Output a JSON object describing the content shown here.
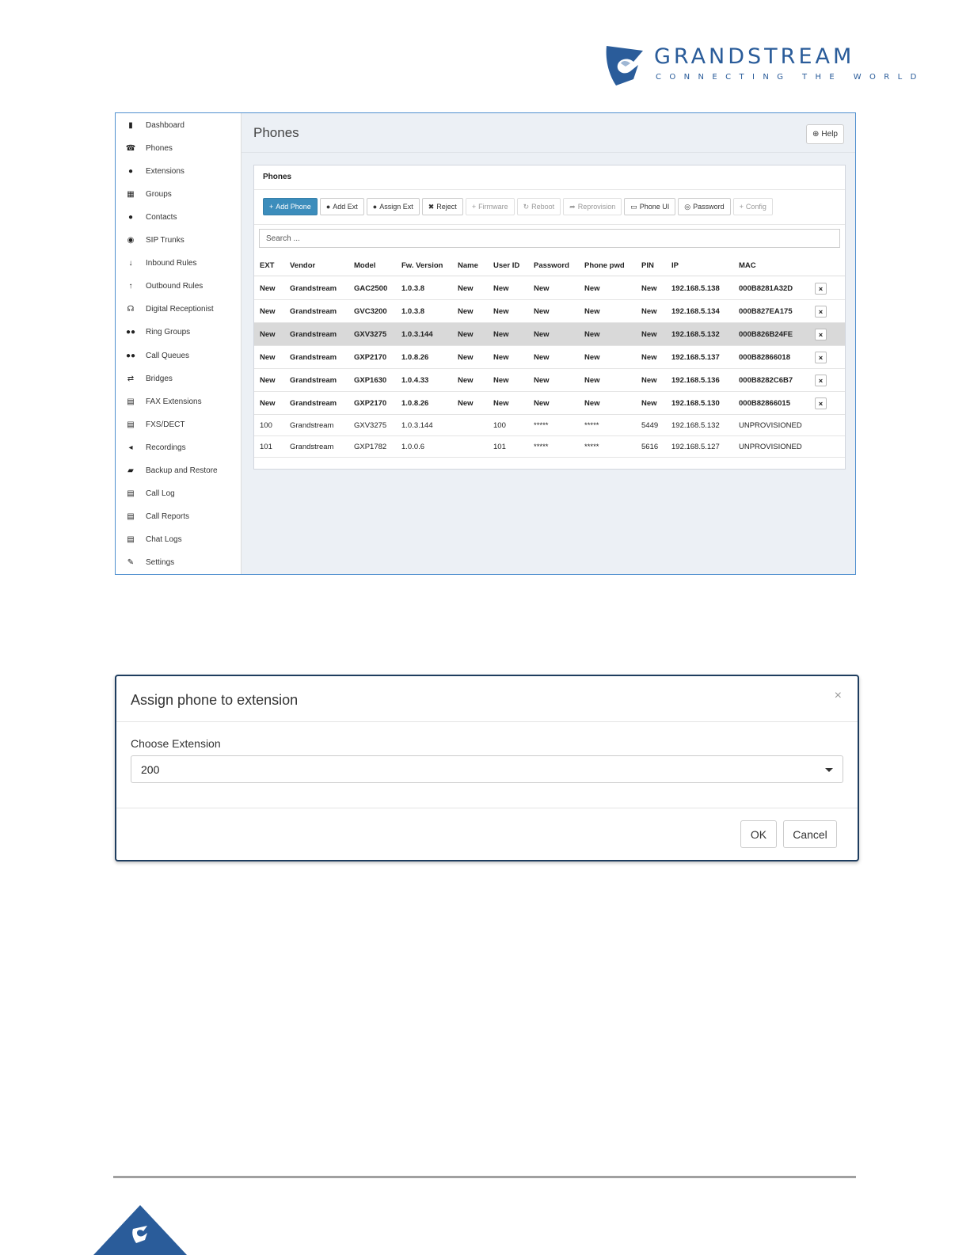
{
  "brand": {
    "name": "GRANDSTREAM",
    "tagline": "CONNECTING THE WORLD",
    "primary_color": "#2a5c9a"
  },
  "sidebar": {
    "items": [
      {
        "label": "Dashboard",
        "icon": "bar-chart-icon"
      },
      {
        "label": "Phones",
        "icon": "phone-icon"
      },
      {
        "label": "Extensions",
        "icon": "user-icon"
      },
      {
        "label": "Groups",
        "icon": "grid-icon"
      },
      {
        "label": "Contacts",
        "icon": "user-icon"
      },
      {
        "label": "SIP Trunks",
        "icon": "globe-icon"
      },
      {
        "label": "Inbound Rules",
        "icon": "arrow-down-icon"
      },
      {
        "label": "Outbound Rules",
        "icon": "arrow-up-icon"
      },
      {
        "label": "Digital Receptionist",
        "icon": "headset-icon"
      },
      {
        "label": "Ring Groups",
        "icon": "users-icon"
      },
      {
        "label": "Call Queues",
        "icon": "users-icon"
      },
      {
        "label": "Bridges",
        "icon": "exchange-icon"
      },
      {
        "label": "FAX Extensions",
        "icon": "fax-icon"
      },
      {
        "label": "FXS/DECT",
        "icon": "fax-icon"
      },
      {
        "label": "Recordings",
        "icon": "speaker-icon"
      },
      {
        "label": "Backup and Restore",
        "icon": "folder-open-icon"
      },
      {
        "label": "Call Log",
        "icon": "list-icon"
      },
      {
        "label": "Call Reports",
        "icon": "list-icon"
      },
      {
        "label": "Chat Logs",
        "icon": "list-icon"
      },
      {
        "label": "Settings",
        "icon": "wrench-icon"
      }
    ]
  },
  "page": {
    "title": "Phones",
    "help_label": "Help"
  },
  "panel": {
    "title": "Phones",
    "toolbar": [
      {
        "label": "Add Phone",
        "icon": "plus-icon",
        "state": "primary"
      },
      {
        "label": "Add Ext",
        "icon": "user-icon",
        "state": "normal"
      },
      {
        "label": "Assign Ext",
        "icon": "user-icon",
        "state": "normal"
      },
      {
        "label": "Reject",
        "icon": "times-icon",
        "state": "normal"
      },
      {
        "label": "Firmware",
        "icon": "plus-icon",
        "state": "disabled"
      },
      {
        "label": "Reboot",
        "icon": "refresh-icon",
        "state": "disabled"
      },
      {
        "label": "Reprovision",
        "icon": "share-icon",
        "state": "disabled"
      },
      {
        "label": "Phone UI",
        "icon": "window-icon",
        "state": "normal"
      },
      {
        "label": "Password",
        "icon": "eye-slash-icon",
        "state": "normal"
      },
      {
        "label": "Config",
        "icon": "plus-icon",
        "state": "disabled"
      }
    ],
    "search_placeholder": "Search ...",
    "columns": [
      "EXT",
      "Vendor",
      "Model",
      "Fw. Version",
      "Name",
      "User ID",
      "Password",
      "Phone pwd",
      "PIN",
      "IP",
      "MAC"
    ],
    "rows": [
      {
        "cells": [
          "New",
          "Grandstream",
          "GAC2500",
          "1.0.3.8",
          "New",
          "New",
          "New",
          "New",
          "New",
          "192.168.5.138",
          "000B8281A32D"
        ],
        "bold": true,
        "selected": false,
        "deletable": true
      },
      {
        "cells": [
          "New",
          "Grandstream",
          "GVC3200",
          "1.0.3.8",
          "New",
          "New",
          "New",
          "New",
          "New",
          "192.168.5.134",
          "000B827EA175"
        ],
        "bold": true,
        "selected": false,
        "deletable": true
      },
      {
        "cells": [
          "New",
          "Grandstream",
          "GXV3275",
          "1.0.3.144",
          "New",
          "New",
          "New",
          "New",
          "New",
          "192.168.5.132",
          "000B826B24FE"
        ],
        "bold": true,
        "selected": true,
        "deletable": true
      },
      {
        "cells": [
          "New",
          "Grandstream",
          "GXP2170",
          "1.0.8.26",
          "New",
          "New",
          "New",
          "New",
          "New",
          "192.168.5.137",
          "000B82866018"
        ],
        "bold": true,
        "selected": false,
        "deletable": true
      },
      {
        "cells": [
          "New",
          "Grandstream",
          "GXP1630",
          "1.0.4.33",
          "New",
          "New",
          "New",
          "New",
          "New",
          "192.168.5.136",
          "000B8282C6B7"
        ],
        "bold": true,
        "selected": false,
        "deletable": true
      },
      {
        "cells": [
          "New",
          "Grandstream",
          "GXP2170",
          "1.0.8.26",
          "New",
          "New",
          "New",
          "New",
          "New",
          "192.168.5.130",
          "000B82866015"
        ],
        "bold": true,
        "selected": false,
        "deletable": true
      },
      {
        "cells": [
          "100",
          "Grandstream",
          "GXV3275",
          "1.0.3.144",
          "",
          "100",
          "*****",
          "*****",
          "5449",
          "192.168.5.132",
          "UNPROVISIONED"
        ],
        "bold": false,
        "selected": false,
        "deletable": false
      },
      {
        "cells": [
          "101",
          "Grandstream",
          "GXP1782",
          "1.0.0.6",
          "",
          "101",
          "*****",
          "*****",
          "5616",
          "192.168.5.127",
          "UNPROVISIONED"
        ],
        "bold": false,
        "selected": false,
        "deletable": false
      }
    ],
    "delete_glyph": "×"
  },
  "dialog": {
    "title": "Assign phone to extension",
    "close_glyph": "×",
    "field_label": "Choose Extension",
    "selected_value": "200",
    "ok_label": "OK",
    "cancel_label": "Cancel"
  }
}
